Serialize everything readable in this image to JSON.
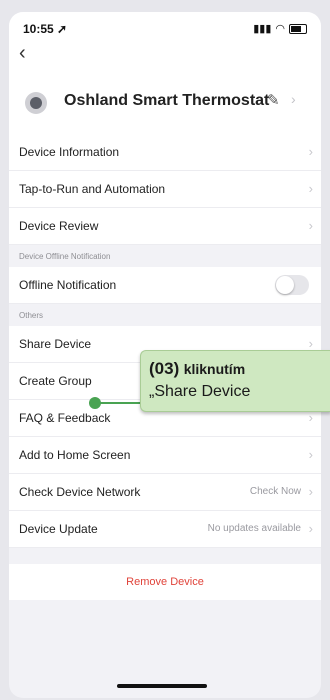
{
  "status_bar": {
    "time": "10:55",
    "icons": [
      "location-arrow-icon",
      "signal-icon",
      "wifi-icon",
      "battery-icon"
    ]
  },
  "nav": {
    "back_icon": "chevron-left-icon"
  },
  "device": {
    "name": "Oshland Smart Thermostat"
  },
  "rows_group1": [
    {
      "label": "Device Information"
    },
    {
      "label": "Tap-to-Run and Automation"
    },
    {
      "label": "Device Review"
    }
  ],
  "section_offline": {
    "title": "Device Offline Notification"
  },
  "offline_notification": {
    "label": "Offline Notification",
    "enabled": false
  },
  "section_others": {
    "title": "Others"
  },
  "rows_others": [
    {
      "label": "Share Device"
    },
    {
      "label": "Create Group"
    },
    {
      "label": "FAQ & Feedback"
    },
    {
      "label": "Add to Home Screen"
    },
    {
      "label": "Check Device Network",
      "value": "Check Now"
    },
    {
      "label": "Device Update",
      "value": "No updates available"
    }
  ],
  "remove": {
    "label": "Remove Device"
  },
  "callout": {
    "number": "(03)",
    "text": "kliknutím",
    "line2": "„Share Device"
  },
  "colors": {
    "accent_green": "#49a352",
    "callout_bg": "#cfe8c1",
    "danger": "#e0433a"
  }
}
